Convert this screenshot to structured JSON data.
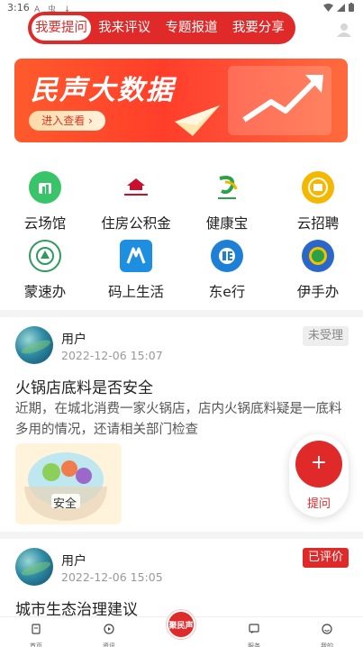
{
  "statusbar": {
    "time": "3:16",
    "notifications": "A 虫 ↓"
  },
  "topnav": {
    "tabs": [
      {
        "label": "我要提问",
        "active": true
      },
      {
        "label": "我来评议",
        "active": false
      },
      {
        "label": "专题报道",
        "active": false
      },
      {
        "label": "我要分享",
        "active": false
      }
    ]
  },
  "banner": {
    "title": "民声大数据",
    "cta": "进入查看 ›"
  },
  "services": [
    {
      "label": "云场馆",
      "icon": "venue-icon",
      "color": "#39c46a"
    },
    {
      "label": "住房公积金",
      "icon": "housing-fund-icon",
      "color": "#c8102e"
    },
    {
      "label": "健康宝",
      "icon": "health-icon",
      "color": "#2aa14a"
    },
    {
      "label": "云招聘",
      "icon": "recruit-icon",
      "color": "#f5b700"
    },
    {
      "label": "蒙速办",
      "icon": "mengsuban-icon",
      "color": "#2f9a5c"
    },
    {
      "label": "码上生活",
      "icon": "code-life-icon",
      "color": "#1e8fe0"
    },
    {
      "label": "东e行",
      "icon": "dong-e-icon",
      "color": "#1e7fd6"
    },
    {
      "label": "伊手办",
      "icon": "yishouban-icon",
      "color": "#2b66c9"
    }
  ],
  "posts": [
    {
      "user": "用户",
      "date": "2022-12-06 15:07",
      "status": "未受理",
      "title": "火锅店底料是否安全",
      "body": "近期，在城北消费一家火锅店，店内火锅底料疑是一底料多用的情况，还请相关部门检查",
      "thumb_text": "安全"
    },
    {
      "user": "用户",
      "date": "2022-12-06 15:05",
      "status": "已评价",
      "title": "城市生态治理建议"
    }
  ],
  "fab": {
    "label": "提问",
    "symbol": "+"
  },
  "bottombar": {
    "items": [
      {
        "label": "首页",
        "icon": "home-icon"
      },
      {
        "label": "资讯",
        "icon": "news-icon"
      },
      {
        "label": "聚民声",
        "icon": "center-logo-icon"
      },
      {
        "label": "服务",
        "icon": "service-icon"
      },
      {
        "label": "我的",
        "icon": "profile-icon"
      }
    ]
  },
  "colors": {
    "brand": "#e02a2a",
    "text": "#222222",
    "muted": "#999999"
  }
}
